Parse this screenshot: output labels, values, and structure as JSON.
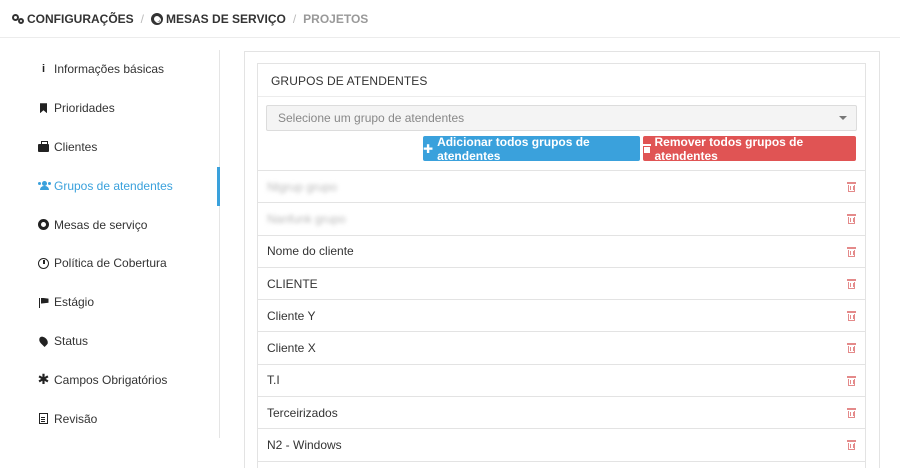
{
  "breadcrumb": {
    "items": [
      {
        "label": "CONFIGURAÇÕES",
        "icon": "cogs-icon",
        "active": true
      },
      {
        "label": "MESAS DE SERVIÇO",
        "icon": "lifebuoy-icon",
        "active": true
      },
      {
        "label": "PROJETOS",
        "active": false
      }
    ],
    "separator": "/"
  },
  "sidebar": {
    "items": [
      {
        "label": "Informações básicas",
        "icon": "info-icon"
      },
      {
        "label": "Prioridades",
        "icon": "bookmark-icon"
      },
      {
        "label": "Clientes",
        "icon": "briefcase-icon"
      },
      {
        "label": "Grupos de atendentes",
        "icon": "users-icon",
        "active": true
      },
      {
        "label": "Mesas de serviço",
        "icon": "lifebuoy-icon"
      },
      {
        "label": "Política de Cobertura",
        "icon": "clock-icon"
      },
      {
        "label": "Estágio",
        "icon": "flag-icon"
      },
      {
        "label": "Status",
        "icon": "map-marker-icon"
      },
      {
        "label": "Campos Obrigatórios",
        "icon": "asterisk-icon"
      },
      {
        "label": "Revisão",
        "icon": "document-icon"
      }
    ],
    "active_color": "#3aa1dc"
  },
  "panel": {
    "title": "GRUPOS DE ATENDENTES",
    "select_placeholder": "Selecione um grupo de atendentes",
    "add_all_label": "Adicionar todos grupos de atendentes",
    "remove_all_label": "Remover todos grupos de atendentes",
    "add_color": "#3aa1dc",
    "remove_color": "#e05454",
    "groups": [
      {
        "name": "Ntgrup grupo",
        "blurred": true
      },
      {
        "name": "Nanfunk grupo",
        "blurred": true
      },
      {
        "name": "Nome do cliente",
        "blurred": false
      },
      {
        "name": "CLIENTE",
        "blurred": false
      },
      {
        "name": "Cliente Y",
        "blurred": false
      },
      {
        "name": "Cliente X",
        "blurred": false
      },
      {
        "name": "T.I",
        "blurred": false
      },
      {
        "name": "Terceirizados",
        "blurred": false
      },
      {
        "name": "N2 - Windows",
        "blurred": false
      }
    ]
  }
}
